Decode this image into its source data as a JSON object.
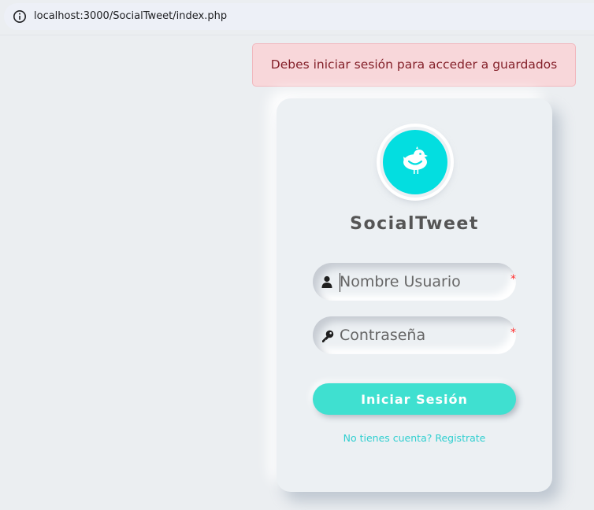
{
  "browser": {
    "url": "localhost:3000/SocialTweet/index.php",
    "info_icon": "info-icon"
  },
  "alert": {
    "message": "Debes iniciar sesión para acceder a guardados",
    "color_bg": "#f8d7da",
    "color_text": "#842029"
  },
  "login": {
    "logo_icon": "bird-icon",
    "app_name": "SocialTweet",
    "username": {
      "placeholder": "Nombre Usuario",
      "value": "",
      "icon": "user-icon",
      "required_mark": "*"
    },
    "password": {
      "placeholder": "Contraseña",
      "value": "",
      "icon": "key-icon",
      "required_mark": "*"
    },
    "submit_label": "Iniciar Sesión",
    "register_text": "No tienes cuenta? Registrate"
  },
  "colors": {
    "background": "#ecf0f3",
    "accent": "#03dee0",
    "button": "#3fe0d0",
    "link": "#30cfd0",
    "required": "#ff2b2b"
  }
}
